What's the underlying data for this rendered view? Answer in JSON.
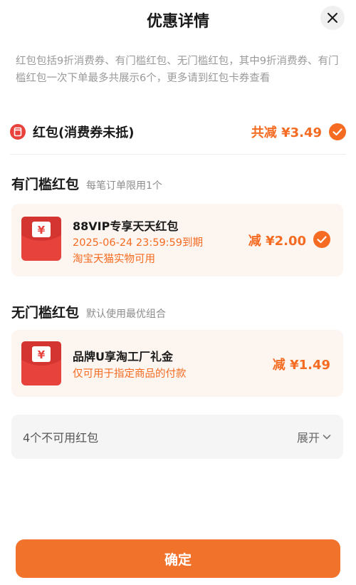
{
  "header": {
    "title": "优惠详情"
  },
  "notice": "红包包括9折消费券、有门槛红包、无门槛红包，其中9折消费券、有门槛红包一次下单最多共展示6个，更多请到红包卡券查看",
  "summary": {
    "label": "红包(消费券未抵)",
    "total": "共减 ¥3.49"
  },
  "threshold_section": {
    "title": "有门槛红包",
    "hint": "每笔订单限用1个",
    "card": {
      "icon_glyph": "¥",
      "name": "88VIP专享天天红包",
      "expiry": "2025-06-24 23:59:59到期",
      "scope": "淘宝天猫实物可用",
      "amount": "减 ¥2.00"
    }
  },
  "no_threshold_section": {
    "title": "无门槛红包",
    "hint": "默认使用最优组合",
    "card": {
      "icon_glyph": "¥",
      "name": "品牌U享淘工厂礼金",
      "scope": "仅可用于指定商品的付款",
      "amount": "减 ¥1.49"
    }
  },
  "unavailable": {
    "label": "4个不可用红包",
    "expand_label": "展开"
  },
  "footer": {
    "confirm_label": "确定"
  },
  "colors": {
    "accent": "#f46b21",
    "envelope": "#e8423d",
    "card_bg": "#fdf5f0"
  }
}
